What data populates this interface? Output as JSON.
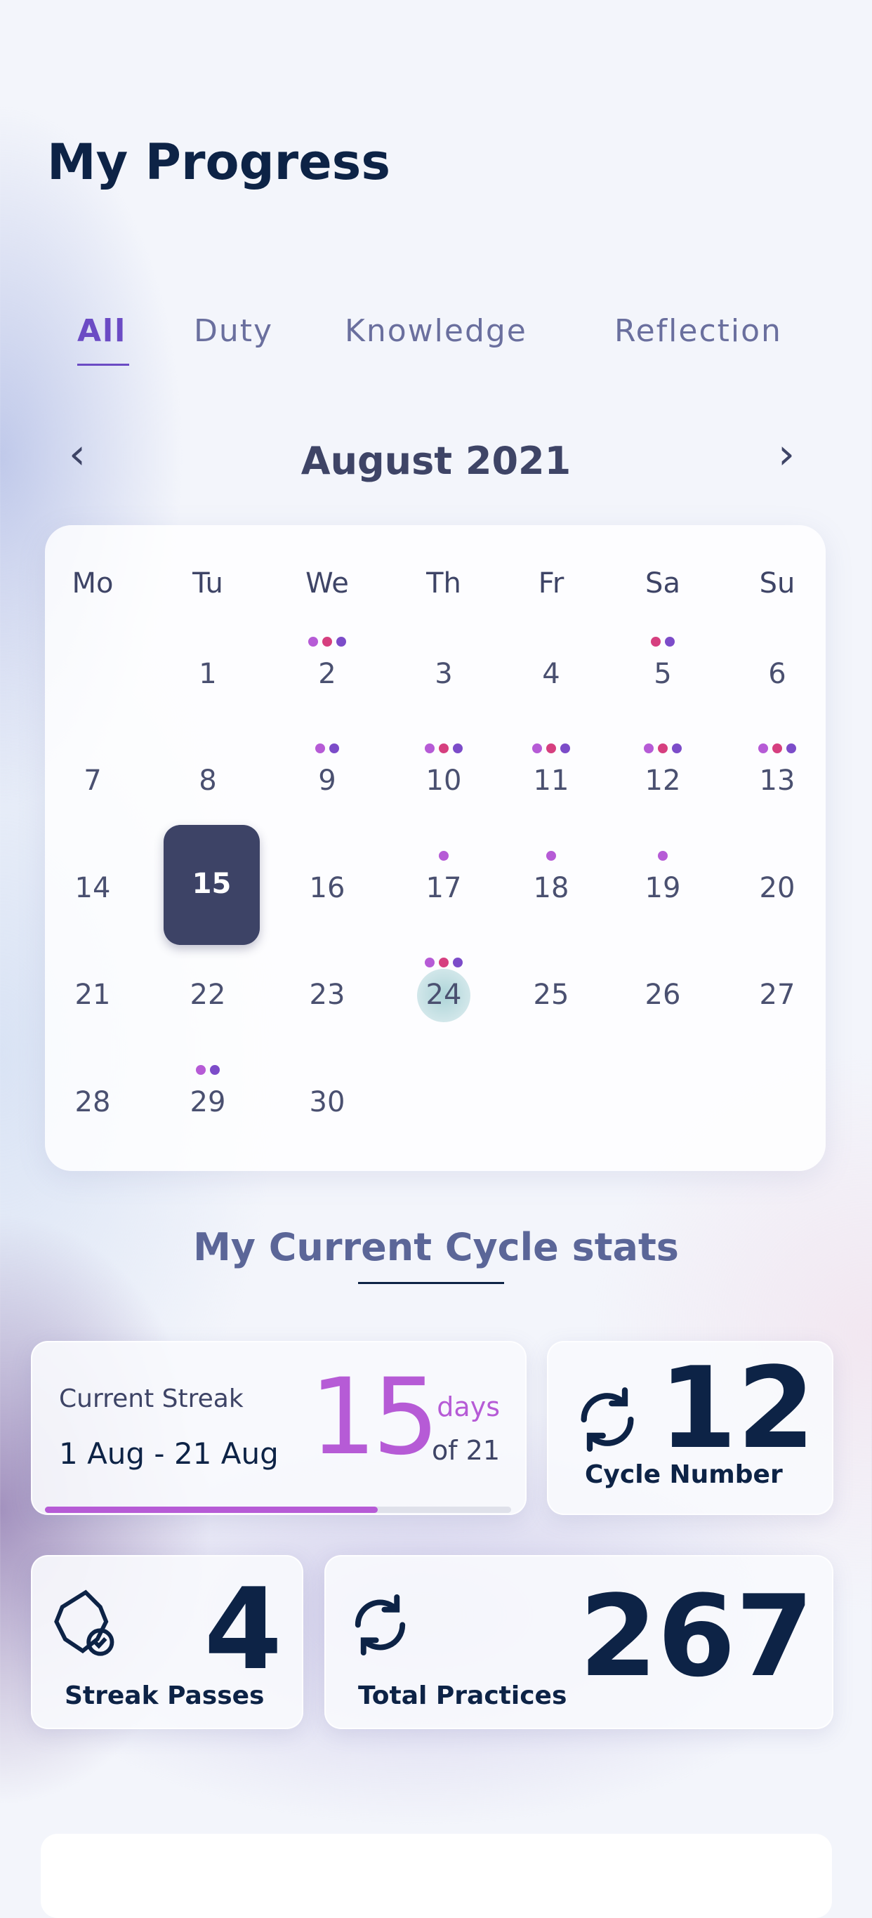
{
  "header": {
    "title": "My Progress"
  },
  "tabs": [
    {
      "label": "All",
      "active": true
    },
    {
      "label": "Duty"
    },
    {
      "label": "Knowledge"
    },
    {
      "label": "Reflection"
    }
  ],
  "calendar": {
    "month_label": "August 2021",
    "prev_icon": "chevron-left-icon",
    "next_icon": "chevron-right-icon",
    "weekdays": [
      "Mo",
      "Tu",
      "We",
      "Th",
      "Fr",
      "Sa",
      "Su"
    ],
    "first_weekday_index": 1,
    "days_in_month": 30,
    "selected_day": 15,
    "marked_day": 24,
    "dot_colors": {
      "a": "#b65bd6",
      "b": "#d63f7f",
      "c": "#7c4cc9"
    },
    "activity": {
      "2": [
        "a",
        "b",
        "c"
      ],
      "5": [
        "b",
        "c"
      ],
      "9": [
        "a",
        "c"
      ],
      "10": [
        "a",
        "b",
        "c"
      ],
      "11": [
        "a",
        "b",
        "c"
      ],
      "12": [
        "a",
        "b",
        "c"
      ],
      "13": [
        "a",
        "b",
        "c"
      ],
      "17": [
        "a"
      ],
      "18": [
        "a"
      ],
      "19": [
        "a"
      ],
      "24": [
        "a",
        "b",
        "c"
      ],
      "29": [
        "a",
        "c"
      ]
    }
  },
  "stats": {
    "title": "My Current Cycle stats",
    "streak": {
      "label": "Current Streak",
      "range": "1 Aug - 21 Aug",
      "value": "15",
      "unit": "days",
      "of": "of 21",
      "progress": 0.714,
      "color": "#b65bd6"
    },
    "cycle": {
      "value": "12",
      "label": "Cycle Number",
      "icon": "refresh-icon"
    },
    "passes": {
      "value": "4",
      "label": "Streak Passes",
      "icon": "badge-check-icon"
    },
    "practices": {
      "value": "267",
      "label": "Total Practices",
      "icon": "refresh-icon"
    }
  }
}
